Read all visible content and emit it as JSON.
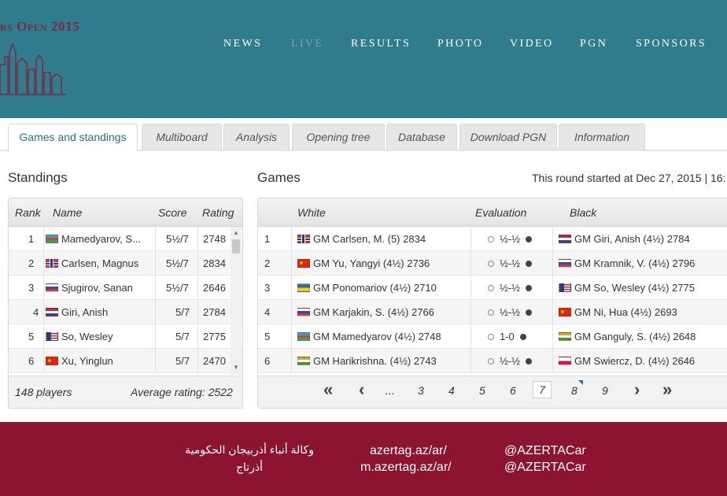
{
  "header": {
    "brand": "rs Open 2015",
    "nav": [
      {
        "label": "NEWS",
        "active": false
      },
      {
        "label": "LIVE",
        "active": true
      },
      {
        "label": "RESULTS",
        "active": false
      },
      {
        "label": "PHOTO",
        "active": false
      },
      {
        "label": "VIDEO",
        "active": false
      },
      {
        "label": "PGN",
        "active": false
      },
      {
        "label": "SPONSORS",
        "active": false
      }
    ]
  },
  "tabs": [
    {
      "label": "Games and standings",
      "active": true
    },
    {
      "label": "Multiboard",
      "active": false
    },
    {
      "label": "Analysis",
      "active": false
    },
    {
      "label": "Opening tree",
      "active": false
    },
    {
      "label": "Database",
      "active": false
    },
    {
      "label": "Download PGN",
      "active": false
    },
    {
      "label": "Information",
      "active": false
    }
  ],
  "standings": {
    "title": "Standings",
    "columns": {
      "rank": "Rank",
      "name": "Name",
      "score": "Score",
      "rating": "Rating"
    },
    "rows": [
      {
        "rank": "1",
        "flag": "az",
        "name": "Mamedyarov, S...",
        "score": "5½/7",
        "rating": "2748"
      },
      {
        "rank": "2",
        "flag": "no",
        "name": "Carlsen, Magnus",
        "score": "5½/7",
        "rating": "2834"
      },
      {
        "rank": "3",
        "flag": "ru",
        "name": "Sjugirov, Sanan",
        "score": "5½/7",
        "rating": "2646"
      },
      {
        "rank": "4",
        "flag": "nl",
        "name": "Giri, Anish",
        "score": "5/7",
        "rating": "2784"
      },
      {
        "rank": "5",
        "flag": "us",
        "name": "So, Wesley",
        "score": "5/7",
        "rating": "2775"
      },
      {
        "rank": "6",
        "flag": "cn",
        "name": "Xu, Yinglun",
        "score": "5/7",
        "rating": "2470"
      }
    ],
    "players": "148 players",
    "average": "Average rating: 2522"
  },
  "games": {
    "title": "Games",
    "round_info": "This round started at Dec 27, 2015 | 16:",
    "columns": {
      "white": "White",
      "evaluation": "Evaluation",
      "black": "Black"
    },
    "rows": [
      {
        "board": "1",
        "wflag": "no",
        "white": "GM Carlsen, M. (5) 2834",
        "result": "½-½",
        "bflag": "nl",
        "black": "GM Giri, Anish (4½) 2784"
      },
      {
        "board": "2",
        "wflag": "cn",
        "white": "GM Yu, Yangyi (4½) 2736",
        "result": "½-½",
        "bflag": "ru",
        "black": "GM Kramnik, V. (4½) 2796"
      },
      {
        "board": "3",
        "wflag": "ua",
        "white": "GM Ponomariov (4½) 2710",
        "result": "½-½",
        "bflag": "us",
        "black": "GM So, Wesley (4½) 2775"
      },
      {
        "board": "4",
        "wflag": "ru",
        "white": "GM Karjakin, S. (4½) 2766",
        "result": "½-½",
        "bflag": "cn",
        "black": "GM Ni, Hua (4½) 2693"
      },
      {
        "board": "5",
        "wflag": "az",
        "white": "GM Mamedyarov (4½) 2748",
        "result": "1-0",
        "bflag": "in",
        "black": "GM Ganguly, S. (4½) 2648"
      },
      {
        "board": "6",
        "wflag": "in",
        "white": "GM Harikrishna. (4½) 2743",
        "result": "½-½",
        "bflag": "pl",
        "black": "GM Swiercz, D. (4½) 2646"
      }
    ],
    "pager": {
      "first": "«",
      "prev": "‹",
      "ellipsis": "...",
      "pages": [
        "3",
        "4",
        "5",
        "6",
        "7",
        "8",
        "9"
      ],
      "current": "7",
      "next": "›",
      "last": "»"
    }
  },
  "footer": {
    "arabic_line1": "وكالة أنباء أذربيجان الحكومية",
    "arabic_line2": "أذرتاج",
    "url1": "azertag.az/ar/",
    "url2": "m.azertag.az/ar/",
    "handle1": "@AZERTACar",
    "handle2": "@AZERTACar"
  },
  "colors": {
    "header_bg": "#2f7d8c",
    "brand": "#7a2a45",
    "footer_bg": "#8c1430",
    "active_tab_text": "#2f6f80"
  }
}
